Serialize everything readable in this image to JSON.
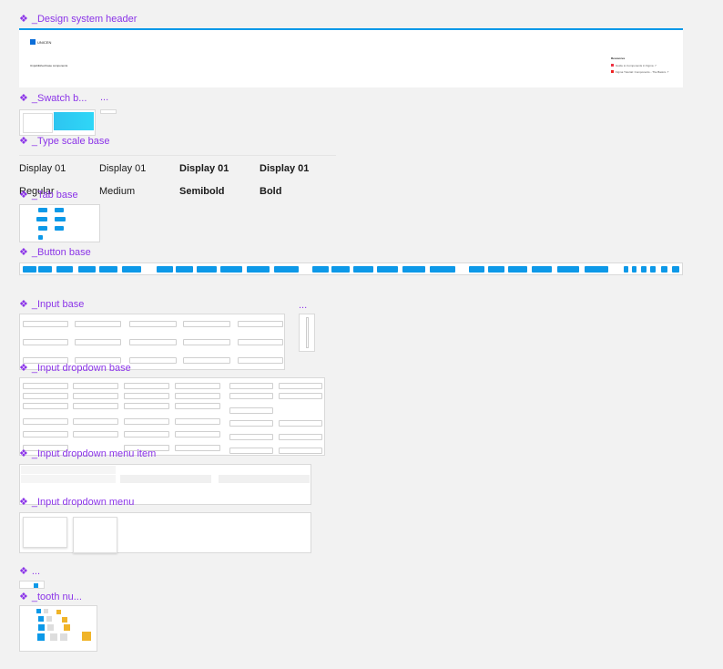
{
  "frames": {
    "header": "_Design system header",
    "swatch": "_Swatch b...",
    "swatch_more": "...",
    "type_scale": "_Type scale base",
    "tab": "_Tab base",
    "button": "_Button base",
    "input": "_Input base",
    "input_more": "...",
    "input_dropdown": "_Input dropdown base",
    "dropdown_item": "_Input dropdown menu item",
    "dropdown_menu": "_Input dropdown menu",
    "unnamed": "...",
    "tooth": "_tooth nu..."
  },
  "header_card": {
    "logo_text": "UNICEN",
    "subtitle": "Unpublished base components",
    "resources_title": "Resources",
    "resource_1": "Guide to Components in Figma ↗",
    "resource_2": "Figma Tutorial: Components - The Basics ↗"
  },
  "type_scale": {
    "row1": [
      "Display 01",
      "Display 01",
      "Display 01",
      "Display 01"
    ],
    "row2": [
      "Regular",
      "Medium",
      "Semibold",
      "Bold"
    ]
  },
  "colors": {
    "accent": "#0d99e8",
    "frame_label": "#8b34e8",
    "tooth": "#f0b429"
  }
}
